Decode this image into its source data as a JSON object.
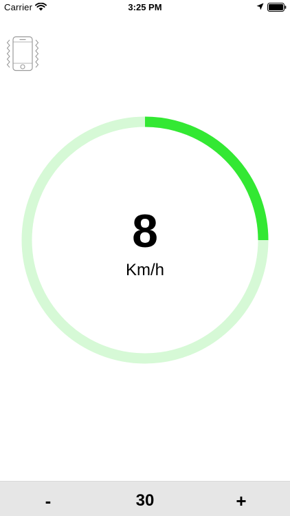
{
  "status_bar": {
    "carrier": "Carrier",
    "time": "3:25 PM",
    "icons": [
      "wifi-icon",
      "location-arrow-icon",
      "battery-icon"
    ]
  },
  "vibrate_icon": "vibrating-phone-icon",
  "speedometer": {
    "value": "8",
    "unit": "Km/h",
    "arc_fraction": 0.25,
    "progress_color": "#33e833",
    "track_color": "#d6f9d6"
  },
  "bottom_bar": {
    "minus_label": "-",
    "limit_value": "30",
    "plus_label": "+"
  }
}
